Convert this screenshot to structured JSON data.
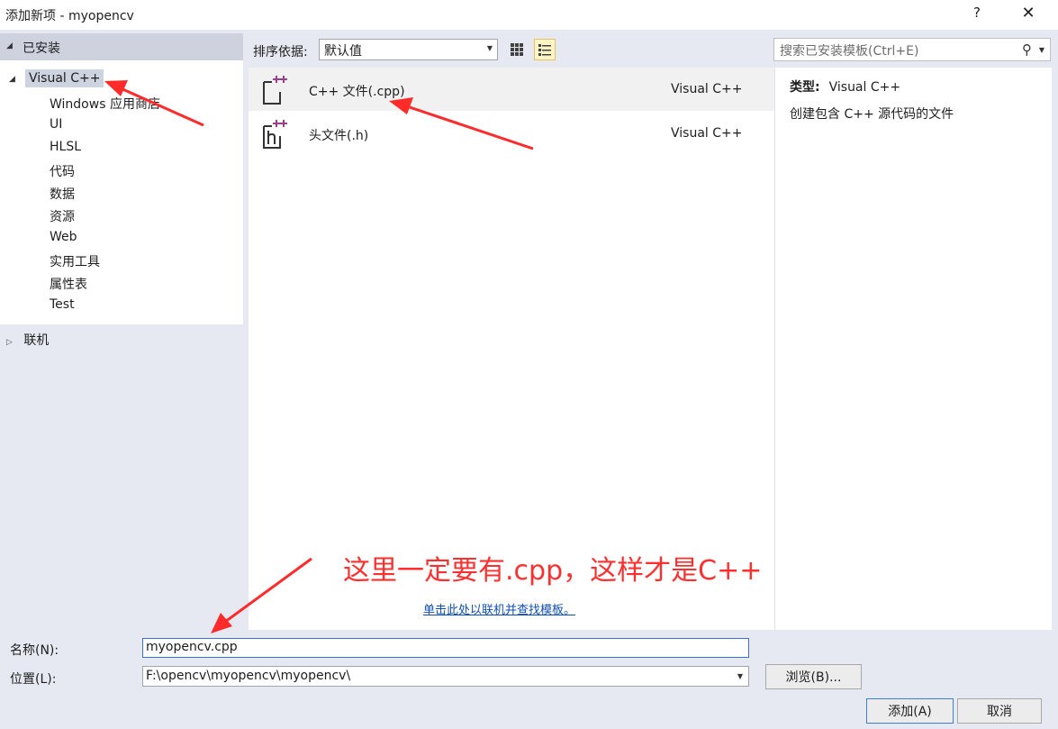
{
  "window": {
    "title": "添加新项 - myopencv",
    "help": "?",
    "close": "✕"
  },
  "left_panel": {
    "installed_label": "已安装",
    "root": "Visual C++",
    "children": [
      "Windows 应用商店",
      "UI",
      "HLSL",
      "代码",
      "数据",
      "资源",
      "Web",
      "实用工具",
      "属性表",
      "Test"
    ],
    "online_label": "联机"
  },
  "toolbar": {
    "sort_label": "排序依据:",
    "sort_value": "默认值",
    "search_placeholder": "搜索已安装模板(Ctrl+E)"
  },
  "templates": [
    {
      "name": "C++ 文件(.cpp)",
      "type": "Visual C++",
      "icon": "cpp-file-icon",
      "selected": true
    },
    {
      "name": "头文件(.h)",
      "type": "Visual C++",
      "icon": "header-file-icon",
      "selected": false
    }
  ],
  "online_link": "单击此处以联机并查找模板。",
  "details": {
    "type_label": "类型:",
    "type_value": "Visual C++",
    "description": "创建包含 C++ 源代码的文件"
  },
  "form": {
    "name_label": "名称(N):",
    "name_value": "myopencv.cpp",
    "location_label": "位置(L):",
    "location_value": "F:\\opencv\\myopencv\\myopencv\\",
    "browse_label": "浏览(B)...",
    "add_label": "添加(A)",
    "cancel_label": "取消"
  },
  "annotation": {
    "text": "这里一定要有.cpp，这样才是C++",
    "color": "#ff2f2f"
  },
  "colors": {
    "panel_bg": "#e6e9f2",
    "selection": "#cdd3df",
    "link": "#0e4fb3",
    "icon_accent": "#9b3e8e"
  }
}
